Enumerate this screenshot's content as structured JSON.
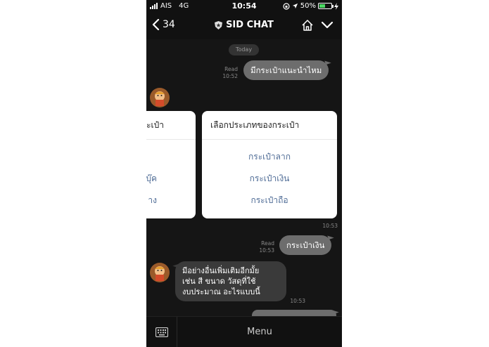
{
  "status_bar": {
    "carrier": "AIS",
    "network": "4G",
    "time": "10:54",
    "battery": "50%",
    "battery_level": 0.5
  },
  "header": {
    "back_count": "34",
    "title": "SID CHAT"
  },
  "date_label": "Today",
  "messages": {
    "out1": {
      "read": "Read",
      "time": "10:52",
      "text": "มีกระเป๋าแนะนำไหม"
    },
    "card_time": "10:53",
    "out2": {
      "read": "Read",
      "time": "10:53",
      "text": "กระเป๋าเงิน"
    },
    "in2": {
      "lines": [
        "มีอย่างอื่นเพิ่มเติมอีกมั้ย",
        "เช่น สี ขนาด วัสดุที่ใช้",
        "งบประมาณ อะไรแบบนี้"
      ],
      "time": "10:53"
    }
  },
  "carousel": {
    "left_card": {
      "title": "ะเป๋า",
      "options": [
        "",
        "บุ๊ค",
        "าง"
      ]
    },
    "main_card": {
      "title": "เลือกประเภทของกระเป๋า",
      "options": [
        "กระเป๋าลาก",
        "กระเป๋าเงิน",
        "กระเป๋าถือ"
      ]
    }
  },
  "bottom_bar": {
    "menu_label": "Menu"
  },
  "colors": {
    "background": "#151515",
    "outgoing_bubble": "#6d6d6d",
    "incoming_bubble": "#3a3a3a",
    "option_text": "#4f6c96",
    "battery_fill": "#4cd964"
  }
}
